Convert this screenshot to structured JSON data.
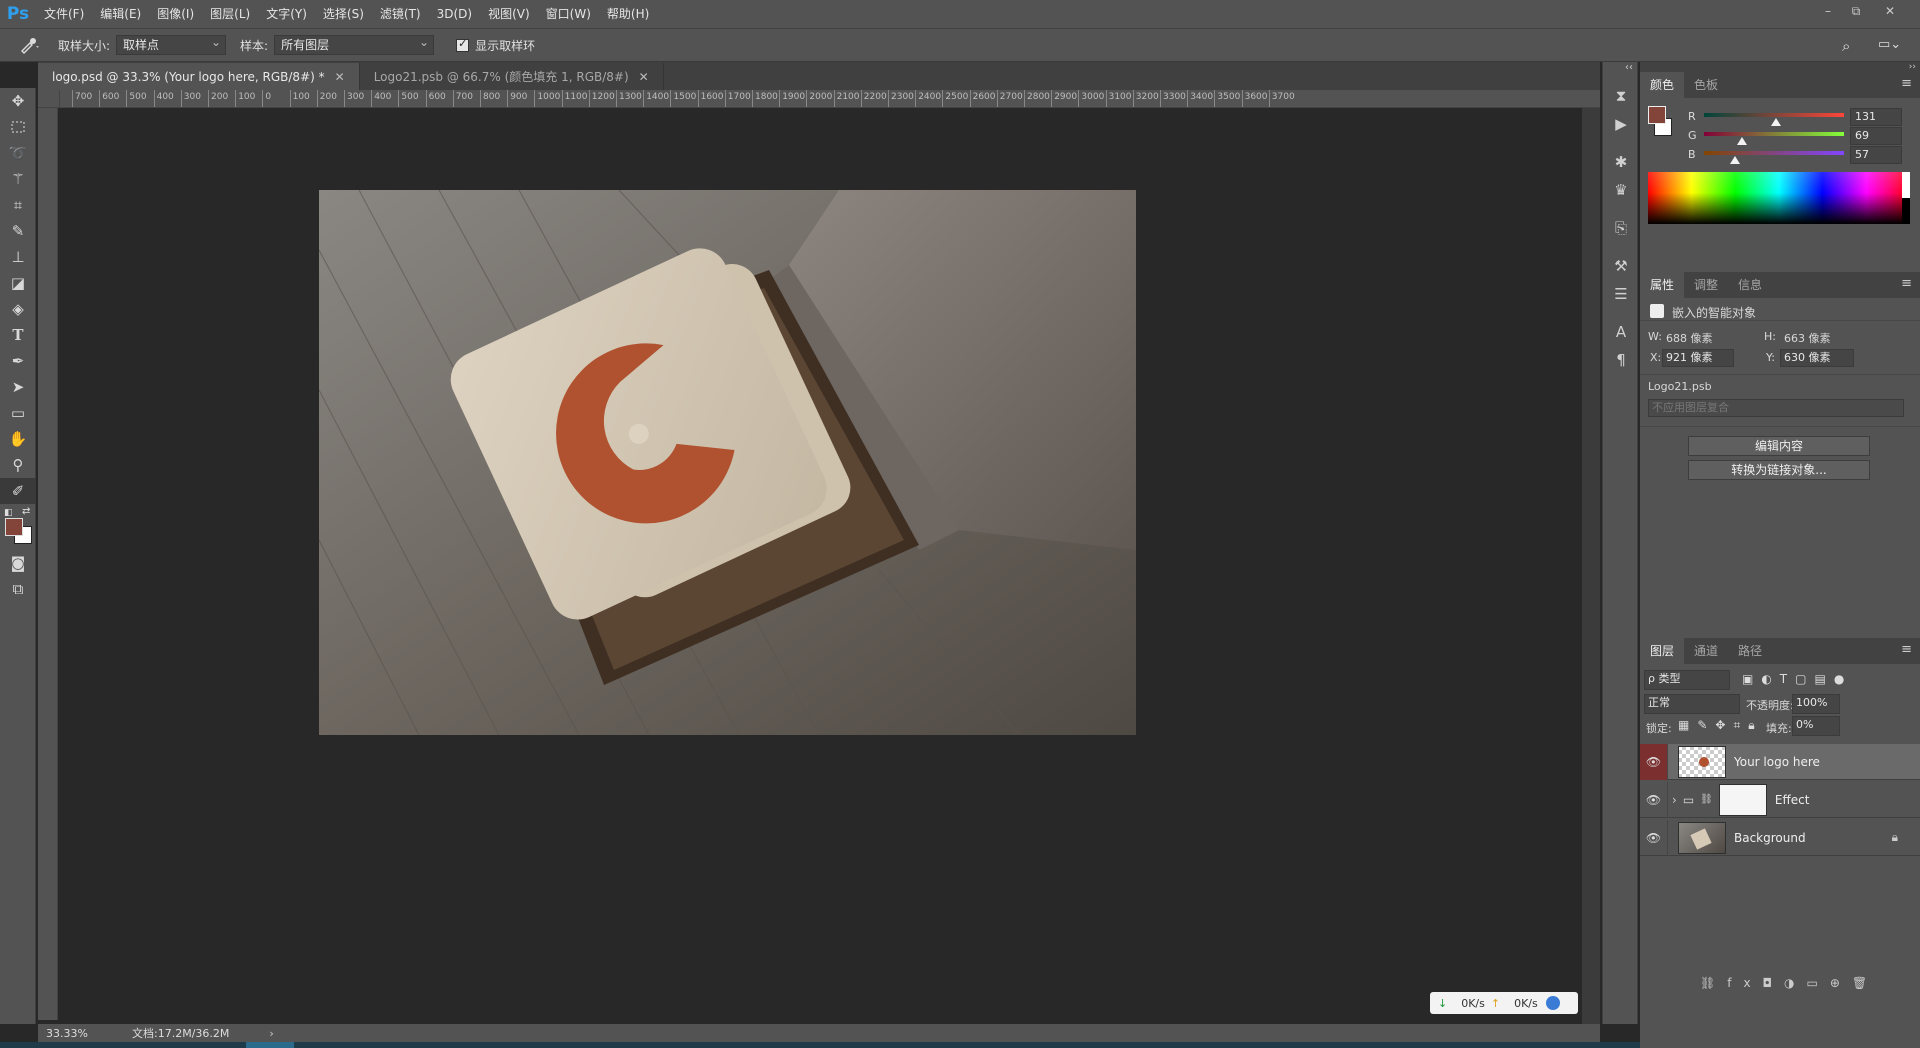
{
  "app": {
    "logo": "Ps"
  },
  "menubar": {
    "items": [
      "文件(F)",
      "编辑(E)",
      "图像(I)",
      "图层(L)",
      "文字(Y)",
      "选择(S)",
      "滤镜(T)",
      "3D(D)",
      "视图(V)",
      "窗口(W)",
      "帮助(H)"
    ],
    "window_controls": [
      "–",
      "⧉",
      "✕"
    ]
  },
  "options": {
    "sample_size_label": "取样大小:",
    "sample_size_value": "取样点",
    "sample_label": "样本:",
    "sample_value": "所有图层",
    "show_ring_label": "显示取样环",
    "show_ring_checked": true
  },
  "tabs": [
    {
      "label": "logo.psd @ 33.3% (Your logo here, RGB/8#) *",
      "active": true
    },
    {
      "label": "Logo21.psb @ 66.7% (颜色填充 1, RGB/8#)",
      "active": false
    }
  ],
  "ruler": {
    "top_ticks": [
      "700",
      "600",
      "500",
      "400",
      "300",
      "200",
      "100",
      "0",
      "100",
      "200",
      "300",
      "400",
      "500",
      "600",
      "700",
      "800",
      "900",
      "1000",
      "1100",
      "1200",
      "1300",
      "1400",
      "1500",
      "1600",
      "1700",
      "1800",
      "1900",
      "2000",
      "2100",
      "2200",
      "2300",
      "2400",
      "2500",
      "2600",
      "2700",
      "2800",
      "2900",
      "3000",
      "3100",
      "3200",
      "3300",
      "3400",
      "3500",
      "3600",
      "3700"
    ]
  },
  "status": {
    "zoom": "33.33%",
    "doc": "文档:17.2M/36.2M"
  },
  "netwidget": {
    "down": "0K/s",
    "up": "0K/s"
  },
  "color_panel": {
    "tabs": [
      "颜色",
      "色板"
    ],
    "fg_color": "#834539",
    "bg_color": "#ffffff",
    "r_label": "R",
    "r": "131",
    "r_fraction": 0.514,
    "g_label": "G",
    "g": "69",
    "g_fraction": 0.271,
    "b_label": "B",
    "b": "57",
    "b_fraction": 0.224
  },
  "props_panel": {
    "tabs": [
      "属性",
      "调整",
      "信息"
    ],
    "object_type": "嵌入的智能对象",
    "w_label": "W:",
    "w": "688 像素",
    "h_label": "H:",
    "h": "663 像素",
    "x_label": "X:",
    "x": "921 像素",
    "y_label": "Y:",
    "y": "630 像素",
    "file_name": "Logo21.psb",
    "comp_value": "不应用图层复合",
    "edit_button": "编辑内容",
    "convert_button": "转换为链接对象..."
  },
  "layers_panel": {
    "tabs": [
      "图层",
      "通道",
      "路径"
    ],
    "filter_kind": "ρ 类型",
    "blend_mode": "正常",
    "opacity_label": "不透明度:",
    "opacity": "100%",
    "lock_label": "锁定:",
    "fill_label": "填充:",
    "fill": "0%",
    "layers": [
      {
        "name": "Your logo here",
        "selected": true
      },
      {
        "name": "Effect",
        "selected": false
      },
      {
        "name": "Background",
        "selected": false
      }
    ]
  },
  "colors": {
    "ui_bg": "#535353",
    "canvas_bg": "#282828",
    "logo_red": "#b0522f"
  }
}
